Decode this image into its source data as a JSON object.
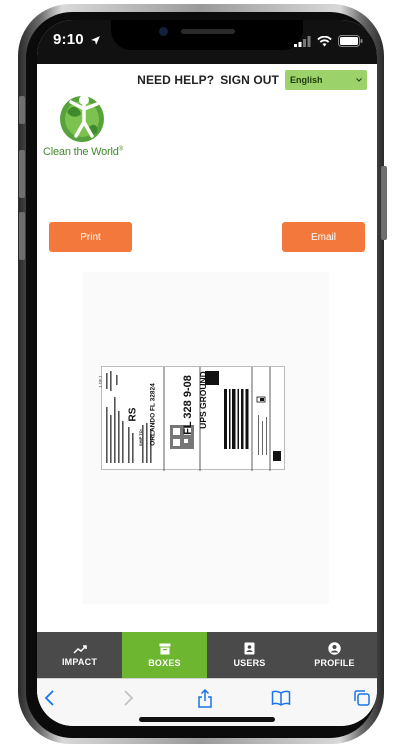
{
  "status_bar": {
    "time": "9:10",
    "icons": [
      "location-arrow-icon",
      "signal-icon",
      "wifi-icon",
      "battery-icon"
    ]
  },
  "top_nav": {
    "help": "NEED HELP?",
    "sign_out": "SIGN OUT",
    "language": "English"
  },
  "logo": {
    "text": "Clean the World",
    "mark": "®"
  },
  "actions": {
    "print": "Print",
    "email": "Email"
  },
  "shipping_label": {
    "service": "UPS GROUND",
    "postal_code": "FL 328 9-08",
    "destination_city": "ORLANDO FL 32824",
    "ship_to_prefix": "SHIP TO:",
    "service_code": "RS",
    "box_count": "1 OF 1"
  },
  "tab_bar": {
    "tabs": [
      {
        "label": "IMPACT",
        "icon": "trend-line-icon",
        "active": false
      },
      {
        "label": "BOXES",
        "icon": "box-icon",
        "active": true
      },
      {
        "label": "USERS",
        "icon": "contact-book-icon",
        "active": false
      },
      {
        "label": "PROFILE",
        "icon": "profile-icon",
        "active": false
      }
    ]
  },
  "colors": {
    "accent_orange": "#f2793b",
    "brand_green": "#6cb72f",
    "language_green": "#9bd26a",
    "tab_bar_gray": "#4a4a4a",
    "safari_blue": "#1a73e8"
  }
}
